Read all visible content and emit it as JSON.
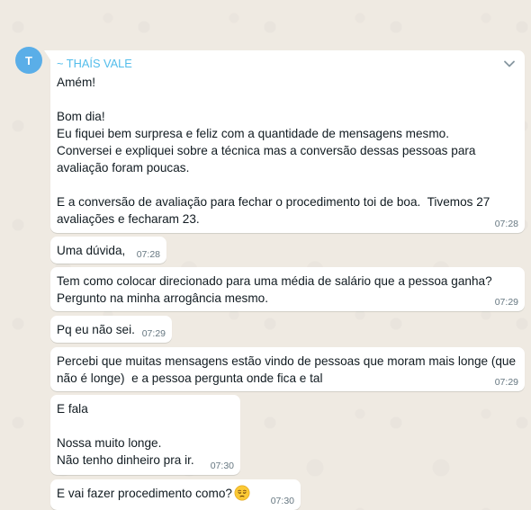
{
  "chat": {
    "avatar_initial": "T",
    "sender_name": "~ THAÍS VALE",
    "messages": [
      {
        "text": "Amém!\n\nBom dia!\nEu fiquei bem surpresa e feliz com a quantidade de mensagens mesmo.\nConversei e expliquei sobre a técnica mas a conversão dessas pessoas para avaliação foram poucas.\n\nE a conversão de avaliação para fechar o procedimento toi de boa.  Tivemos 27 avaliações e fecharam 23.",
        "time": "07:28"
      },
      {
        "text": "Uma dúvida,",
        "time": "07:28"
      },
      {
        "text": "Tem como colocar direcionado para uma média de salário que a pessoa ganha?\nPergunto na minha arrogância mesmo.",
        "time": "07:29"
      },
      {
        "text": "Pq eu não sei.",
        "time": "07:29"
      },
      {
        "text": "Percebi que muitas mensagens estão vindo de pessoas que moram mais longe (que não é longe)  e a pessoa pergunta onde fica e tal",
        "time": "07:29"
      },
      {
        "text": "E fala\n\nNossa muito longe.\nNão tenho dinheiro pra ir.",
        "time": "07:30"
      },
      {
        "text": "E vai fazer procedimento como?",
        "time": "07:30",
        "emoji": "pensive-face-emoji"
      }
    ]
  },
  "colors": {
    "background": "#efeae2",
    "bubble": "#ffffff",
    "sender_name": "#53bdeb",
    "avatar": "#5aaee8",
    "timestamp": "#667781"
  },
  "icons": {
    "menu": "chevron-down-icon"
  }
}
